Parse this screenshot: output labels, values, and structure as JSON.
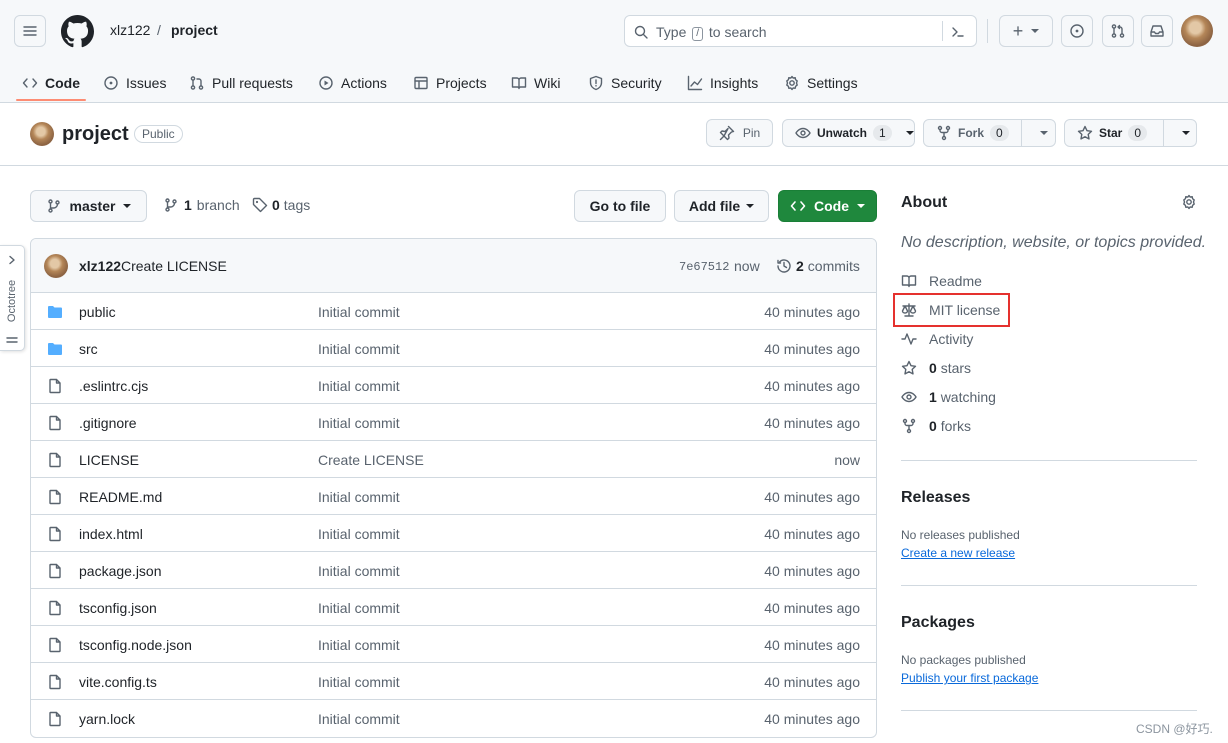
{
  "header": {
    "owner": "xlz122",
    "separator": "/",
    "repo": "project",
    "search_prefix": "Type",
    "search_slash": "/",
    "search_suffix": "to search",
    "plus": "+"
  },
  "tabs": [
    {
      "label": "Code",
      "icon": "code-icon",
      "active": true
    },
    {
      "label": "Issues",
      "icon": "issue-icon"
    },
    {
      "label": "Pull requests",
      "icon": "pull-request-icon"
    },
    {
      "label": "Actions",
      "icon": "play-icon"
    },
    {
      "label": "Projects",
      "icon": "table-icon"
    },
    {
      "label": "Wiki",
      "icon": "book-icon"
    },
    {
      "label": "Security",
      "icon": "shield-icon"
    },
    {
      "label": "Insights",
      "icon": "graph-icon"
    },
    {
      "label": "Settings",
      "icon": "gear-icon"
    }
  ],
  "repo": {
    "name": "project",
    "visibility": "Public",
    "pin": "Pin",
    "unwatch": "Unwatch",
    "watch_count": "1",
    "fork": "Fork",
    "fork_count": "0",
    "star": "Star",
    "star_count": "0"
  },
  "toolbar": {
    "branch": "master",
    "branches_count": "1",
    "branches_label": "branch",
    "tags_count": "0",
    "tags_label": "tags",
    "go_to_file": "Go to file",
    "add_file": "Add file",
    "code": "Code"
  },
  "commit": {
    "author": "xlz122",
    "message": "Create LICENSE",
    "sha": "7e67512",
    "time": "now",
    "commits_count": "2",
    "commits_label": "commits"
  },
  "files": [
    {
      "name": "public",
      "type": "folder",
      "message": "Initial commit",
      "age": "40 minutes ago"
    },
    {
      "name": "src",
      "type": "folder",
      "message": "Initial commit",
      "age": "40 minutes ago"
    },
    {
      "name": ".eslintrc.cjs",
      "type": "file",
      "message": "Initial commit",
      "age": "40 minutes ago"
    },
    {
      "name": ".gitignore",
      "type": "file",
      "message": "Initial commit",
      "age": "40 minutes ago"
    },
    {
      "name": "LICENSE",
      "type": "file",
      "message": "Create LICENSE",
      "age": "now"
    },
    {
      "name": "README.md",
      "type": "file",
      "message": "Initial commit",
      "age": "40 minutes ago"
    },
    {
      "name": "index.html",
      "type": "file",
      "message": "Initial commit",
      "age": "40 minutes ago"
    },
    {
      "name": "package.json",
      "type": "file",
      "message": "Initial commit",
      "age": "40 minutes ago"
    },
    {
      "name": "tsconfig.json",
      "type": "file",
      "message": "Initial commit",
      "age": "40 minutes ago"
    },
    {
      "name": "tsconfig.node.json",
      "type": "file",
      "message": "Initial commit",
      "age": "40 minutes ago"
    },
    {
      "name": "vite.config.ts",
      "type": "file",
      "message": "Initial commit",
      "age": "40 minutes ago"
    },
    {
      "name": "yarn.lock",
      "type": "file",
      "message": "Initial commit",
      "age": "40 minutes ago"
    }
  ],
  "about": {
    "title": "About",
    "description": "No description, website, or topics provided.",
    "readme": "Readme",
    "license": "MIT license",
    "activity": "Activity",
    "stars_count": "0",
    "stars_label": "stars",
    "watching_count": "1",
    "watching_label": "watching",
    "forks_count": "0",
    "forks_label": "forks",
    "highlight_color": "#e5312e"
  },
  "releases": {
    "title": "Releases",
    "empty": "No releases published",
    "link": "Create a new release"
  },
  "packages": {
    "title": "Packages",
    "empty": "No packages published",
    "link": "Publish your first package"
  },
  "octotree": {
    "label": "Octotree"
  },
  "watermark": "CSDN @好巧."
}
